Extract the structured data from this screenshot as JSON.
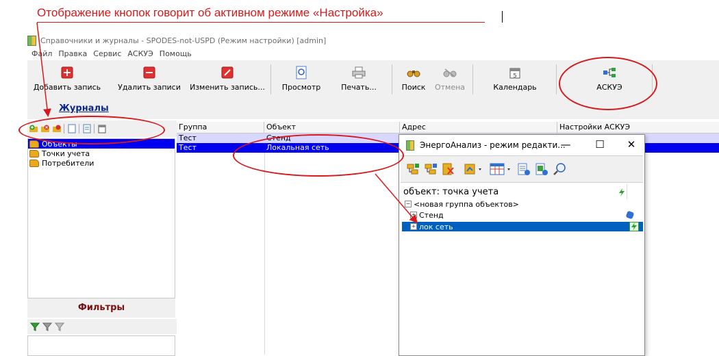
{
  "annotation": {
    "text": "Отображение кнопок говорит об активном режиме «Настройка»",
    "color": "#d7191c"
  },
  "window": {
    "title": "Справочники и журналы - SPODES-not-USPD (Режим настройки) [admin]"
  },
  "menu": [
    "Файл",
    "Правка",
    "Сервис",
    "АСКУЭ",
    "Помощь"
  ],
  "toolbar": {
    "add": "Добавить запись",
    "delete": "Удалить записи",
    "edit": "Изменить запись...",
    "preview": "Просмотр",
    "print": "Печать...",
    "search": "Поиск",
    "cancel": "Отмена",
    "calendar": "Календарь",
    "askue": "АСКУЭ"
  },
  "journals": {
    "header": "Журналы",
    "items": [
      "Объекты",
      "Точки учета",
      "Потребители"
    ]
  },
  "filters": {
    "header": "Фильтры"
  },
  "grid": {
    "columns": [
      "Группа",
      "Объект",
      "Адрес",
      "Настройки АСКУЭ"
    ],
    "rows": [
      {
        "group": "Тест",
        "object": "Стенд"
      },
      {
        "group": "Тест",
        "object": "Локальная сеть"
      }
    ]
  },
  "dialog": {
    "title": "ЭнергоАнализ - режим редакти...",
    "tree_title": "объект: точка учета",
    "tree": [
      "<новая группа объектов>",
      "Стенд",
      "лок сеть"
    ]
  },
  "colors": {
    "selection": "#0000ee",
    "tree_selection": "#0060c0",
    "journals_header": "#0d2a8a",
    "filters_header": "#7b1010"
  }
}
